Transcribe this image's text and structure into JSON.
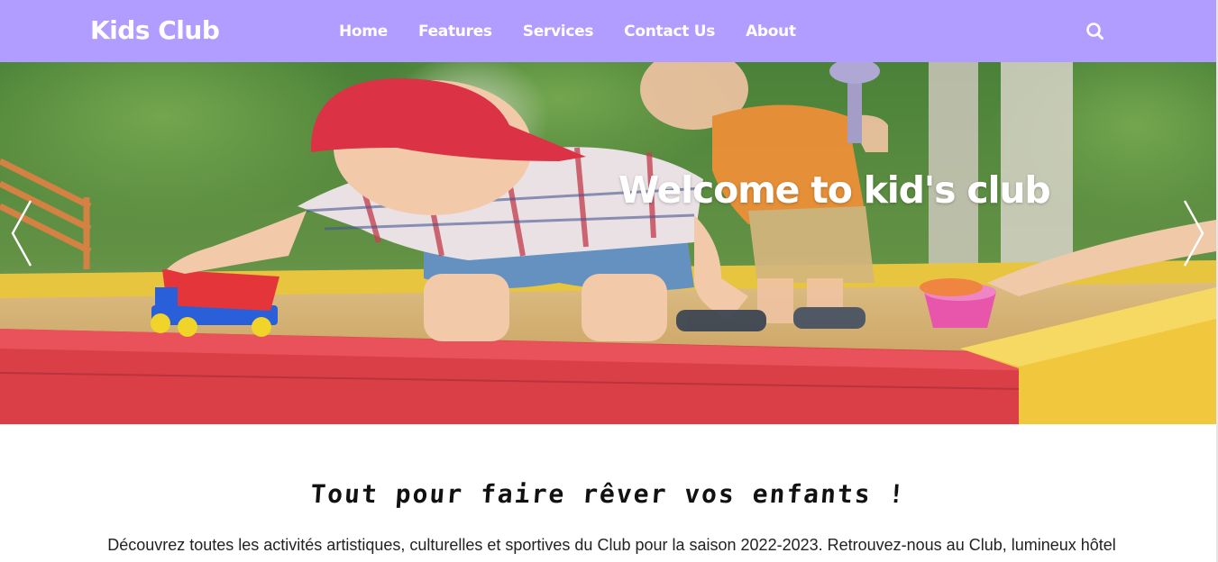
{
  "brand": {
    "name": "Kids Club"
  },
  "nav": {
    "items": [
      {
        "label": "Home"
      },
      {
        "label": "Features"
      },
      {
        "label": "Services"
      },
      {
        "label": "Contact Us"
      },
      {
        "label": "About"
      }
    ],
    "search_icon": "search-icon"
  },
  "hero": {
    "caption": "Welcome to kid's club",
    "prev_icon": "chevron-left-icon",
    "next_icon": "chevron-right-icon"
  },
  "content": {
    "title": "Tout pour faire rêver vos enfants !",
    "intro": "Découvrez toutes les activités artistiques, culturelles et sportives du Club pour la saison 2022-2023. Retrouvez-nous au Club, lumineux hôtel"
  },
  "colors": {
    "navbar_bg": "#b19dff",
    "nav_text": "#ffffff",
    "caption_text": "#ffffff",
    "body_text": "#222222"
  }
}
